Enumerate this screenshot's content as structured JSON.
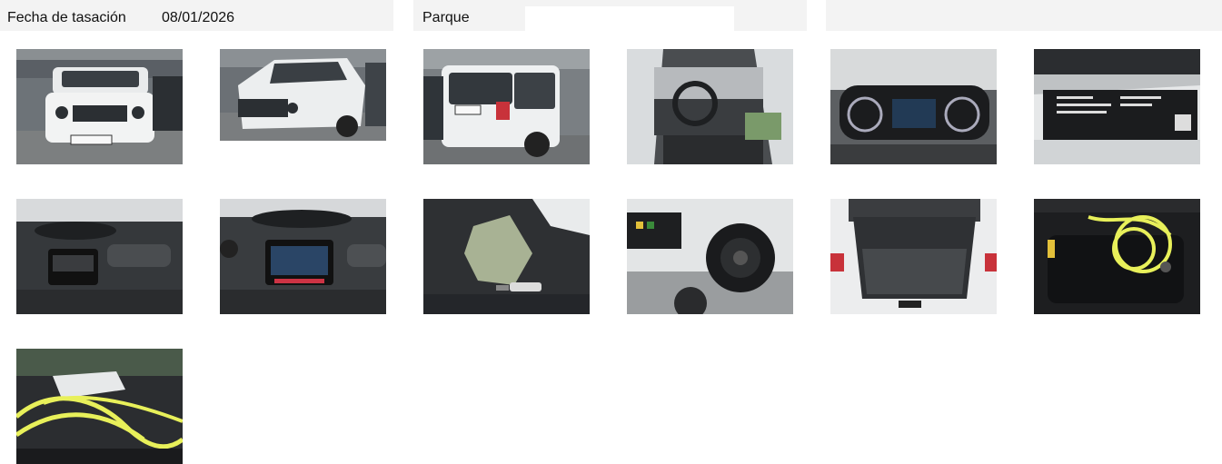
{
  "header": {
    "appraisal_date_label": "Fecha de tasación",
    "appraisal_date_value": "08/01/2026",
    "park_label": "Parque",
    "park_value": ""
  },
  "photos": [
    {
      "name": "photo-front-view"
    },
    {
      "name": "photo-front-three-quarter-view"
    },
    {
      "name": "photo-rear-view"
    },
    {
      "name": "photo-interior-dashboard"
    },
    {
      "name": "photo-instrument-cluster"
    },
    {
      "name": "photo-vin-label"
    },
    {
      "name": "photo-center-console-screen-off"
    },
    {
      "name": "photo-center-console-screen-on"
    },
    {
      "name": "photo-seat-with-keys"
    },
    {
      "name": "photo-fuel-charging-flap"
    },
    {
      "name": "photo-trunk"
    },
    {
      "name": "photo-charging-cable-bag"
    },
    {
      "name": "photo-charging-cable-closeup"
    }
  ],
  "colors": {
    "header_bg": "#f3f3f3",
    "body_bg": "#ffffff",
    "cable_yellow": "#e8f05a"
  }
}
